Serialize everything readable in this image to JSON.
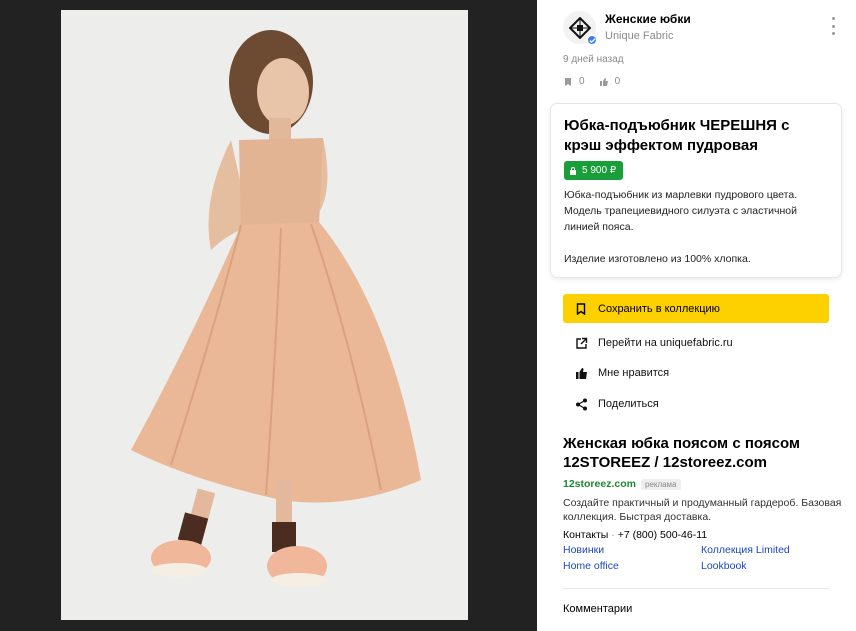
{
  "board": {
    "title": "Женские юбки",
    "channel": "Unique Fabric",
    "date": "9 дней назад",
    "saves_count": "0",
    "likes_count": "0"
  },
  "product": {
    "title": "Юбка-подъюбник ЧЕРЕШНЯ с крэш эффектом пудровая",
    "price": "5 900 ₽",
    "description": "Юбка-подъюбник из марлевки пудрового цвета. Модель трапециевидного силуэта с эластичной линией пояса.",
    "description_extra": "Изделие изготовлено из 100% хлопка."
  },
  "actions": {
    "save_label": "Сохранить в коллекцию",
    "visit_label": "Перейти на uniquefabric.ru",
    "like_label": "Мне нравится",
    "share_label": "Поделиться"
  },
  "ad": {
    "title": "Женская юбка поясом с поясом 12STOREEZ / 12storeez.com",
    "domain": "12storeez.com",
    "tag": "реклама",
    "text": "Создайте практичный и продуманный гардероб. Базовая коллекция. Быстрая доставка.",
    "contacts_label": "Контакты",
    "phone": "+7 (800) 500-46-11",
    "sitelinks": [
      "Новинки",
      "Коллекция Limited",
      "Home office",
      "Lookbook"
    ]
  },
  "comments_label": "Комментарии",
  "colors": {
    "viewer_bg": "#222222",
    "accent_yellow": "#fdd000",
    "price_green": "#1a9e3a",
    "link_blue": "#1a47c4",
    "ad_domain_green": "#1a8a2e"
  },
  "icons": {
    "bookmark": "bookmark-icon",
    "thumb_up": "thumb-up-icon",
    "external_link": "external-link-icon",
    "share": "share-icon",
    "more": "more-vertical-icon",
    "verified": "verified-icon",
    "lock": "lock-icon"
  }
}
